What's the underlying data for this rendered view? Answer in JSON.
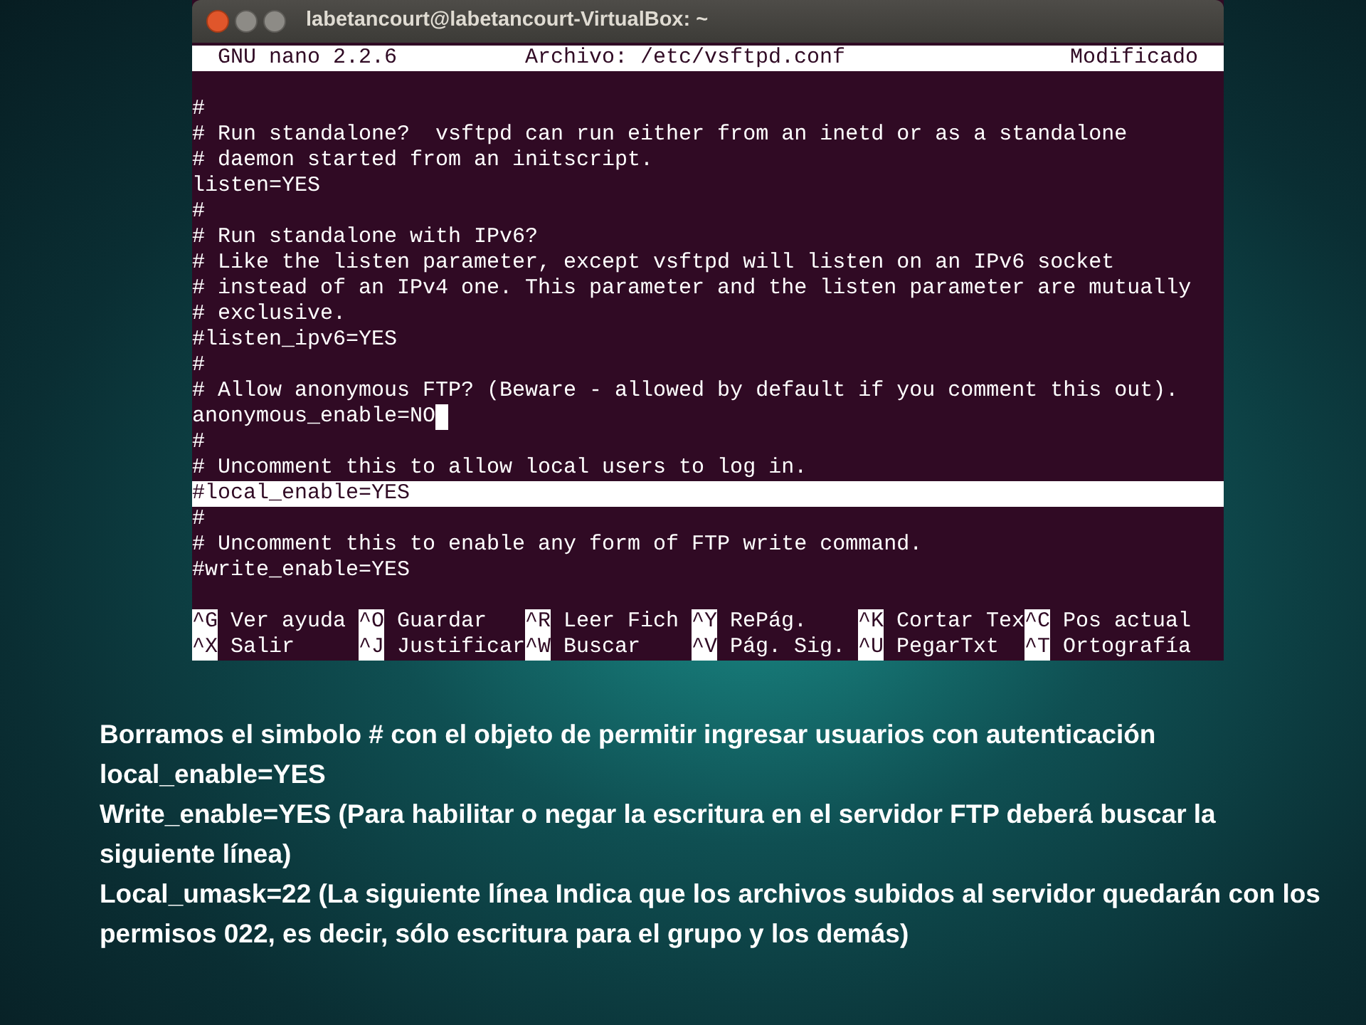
{
  "window": {
    "title": "labetancourt@labetancourt-VirtualBox: ~"
  },
  "nano": {
    "header": {
      "version": "GNU nano 2.2.6",
      "file": "Archivo: /etc/vsftpd.conf",
      "status": "Modificado"
    },
    "lines": [
      {
        "text": "#",
        "highlighted": false,
        "cursor": false
      },
      {
        "text": "# Run standalone?  vsftpd can run either from an inetd or as a standalone",
        "highlighted": false,
        "cursor": false
      },
      {
        "text": "# daemon started from an initscript.",
        "highlighted": false,
        "cursor": false
      },
      {
        "text": "listen=YES",
        "highlighted": false,
        "cursor": false
      },
      {
        "text": "#",
        "highlighted": false,
        "cursor": false
      },
      {
        "text": "# Run standalone with IPv6?",
        "highlighted": false,
        "cursor": false
      },
      {
        "text": "# Like the listen parameter, except vsftpd will listen on an IPv6 socket",
        "highlighted": false,
        "cursor": false
      },
      {
        "text": "# instead of an IPv4 one. This parameter and the listen parameter are mutually",
        "highlighted": false,
        "cursor": false
      },
      {
        "text": "# exclusive.",
        "highlighted": false,
        "cursor": false
      },
      {
        "text": "#listen_ipv6=YES",
        "highlighted": false,
        "cursor": false
      },
      {
        "text": "#",
        "highlighted": false,
        "cursor": false
      },
      {
        "text": "# Allow anonymous FTP? (Beware - allowed by default if you comment this out).",
        "highlighted": false,
        "cursor": false
      },
      {
        "text": "anonymous_enable=NO",
        "highlighted": false,
        "cursor": true
      },
      {
        "text": "#",
        "highlighted": false,
        "cursor": false
      },
      {
        "text": "# Uncomment this to allow local users to log in.",
        "highlighted": false,
        "cursor": false
      },
      {
        "text": "#local_enable=YES",
        "highlighted": true,
        "cursor": false
      },
      {
        "text": "#",
        "highlighted": false,
        "cursor": false
      },
      {
        "text": "# Uncomment this to enable any form of FTP write command.",
        "highlighted": false,
        "cursor": false
      },
      {
        "text": "#write_enable=YES",
        "highlighted": false,
        "cursor": false
      }
    ],
    "shortcuts": [
      {
        "key": "^G",
        "label": "Ver ayuda"
      },
      {
        "key": "^O",
        "label": "Guardar"
      },
      {
        "key": "^R",
        "label": "Leer Fich"
      },
      {
        "key": "^Y",
        "label": "RePág."
      },
      {
        "key": "^K",
        "label": "Cortar Tex"
      },
      {
        "key": "^C",
        "label": "Pos actual"
      },
      {
        "key": "^X",
        "label": "Salir"
      },
      {
        "key": "^J",
        "label": "Justificar"
      },
      {
        "key": "^W",
        "label": "Buscar"
      },
      {
        "key": "^V",
        "label": "Pág. Sig."
      },
      {
        "key": "^U",
        "label": "PegarTxt"
      },
      {
        "key": "^T",
        "label": "Ortografía"
      }
    ]
  },
  "caption": [
    "Borramos el simbolo # con el objeto de permitir ingresar usuarios con autenticación",
    "local_enable=YES",
    "Write_enable=YES (Para habilitar o negar la escritura en el servidor FTP deberá buscar la siguiente línea)",
    "Local_umask=22 (La siguiente línea Indica que los archivos subidos al servidor quedarán con los permisos 022, es decir, sólo escritura para el grupo y los demás)"
  ]
}
